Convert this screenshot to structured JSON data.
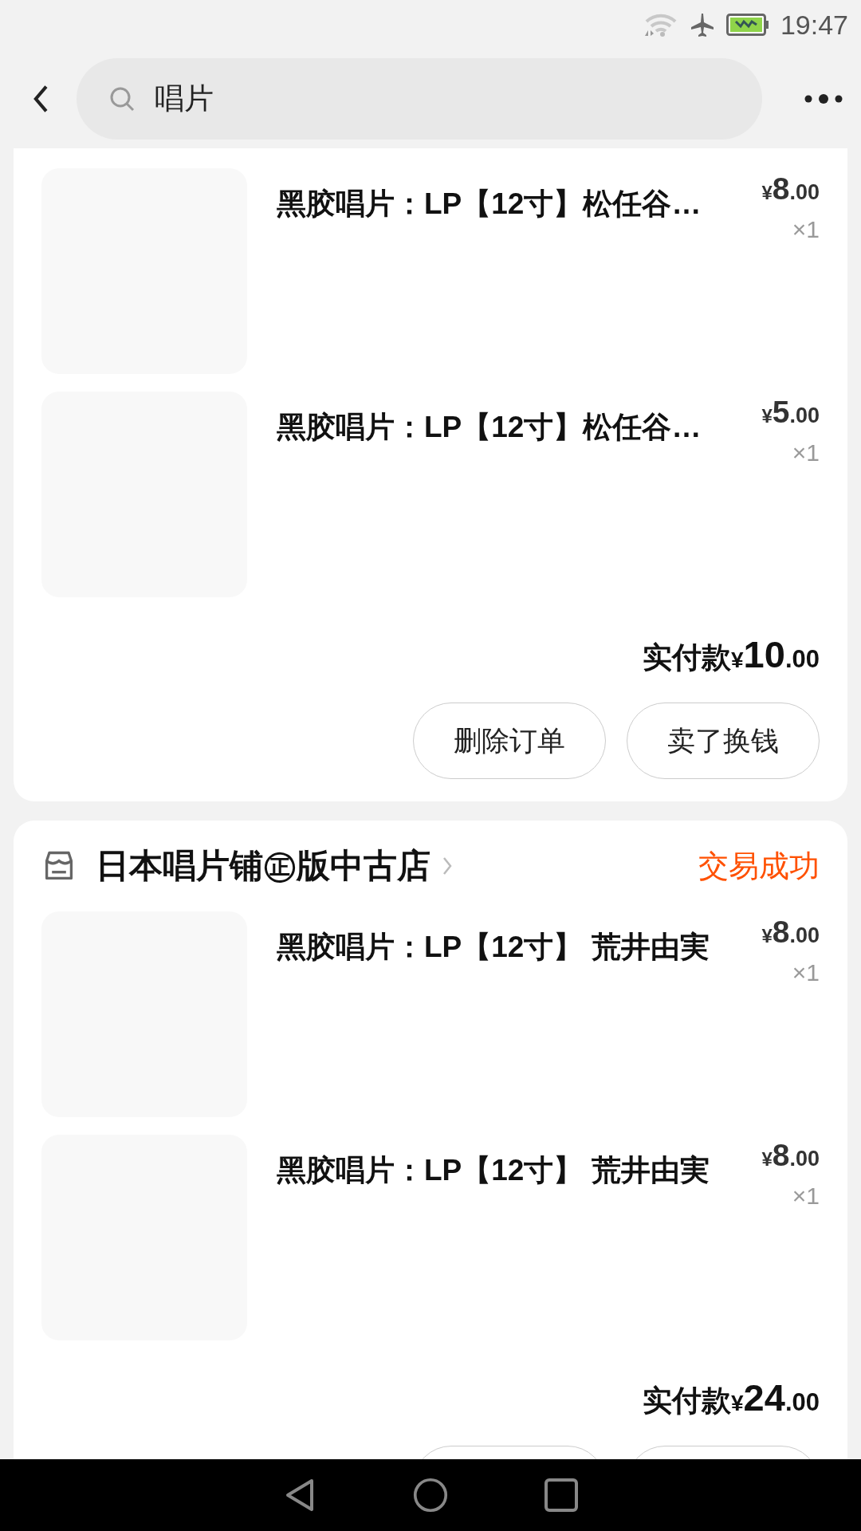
{
  "status_bar": {
    "time": "19:47"
  },
  "search": {
    "value": "唱片"
  },
  "orders": [
    {
      "top_cut": true,
      "items": [
        {
          "title": "黑胶唱片：LP【12寸】松任谷…",
          "price": "¥8.00",
          "quantity": "×1"
        },
        {
          "title": "黑胶唱片：LP【12寸】松任谷…",
          "price": "¥5.00",
          "quantity": "×1"
        }
      ],
      "total_label": "实付款",
      "total": "¥10.00",
      "buttons": [
        {
          "kind": "text",
          "label": "删除订单"
        },
        {
          "kind": "text",
          "label": "卖了换钱"
        }
      ]
    },
    {
      "shop": "日本唱片铺㊣版中古店",
      "status": "交易成功",
      "top_cut": false,
      "items": [
        {
          "title": "黑胶唱片：LP【12寸】 荒井由実",
          "price": "¥8.00",
          "quantity": "×1"
        },
        {
          "title": "黑胶唱片：LP【12寸】 荒井由実",
          "price": "¥8.00",
          "quantity": "×1"
        }
      ],
      "total_label": "实付款",
      "total": "¥24.00",
      "buttons": [
        {
          "kind": "cut"
        },
        {
          "kind": "cut"
        }
      ]
    }
  ]
}
